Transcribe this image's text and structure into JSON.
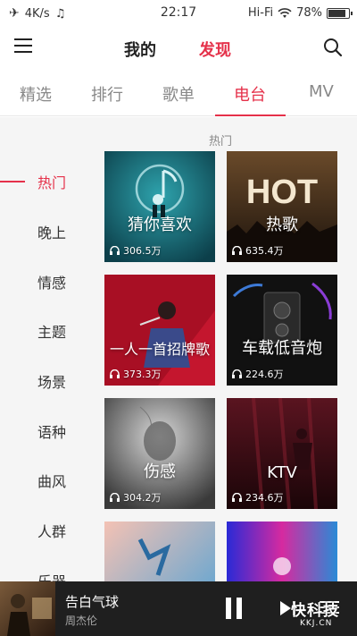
{
  "status_bar": {
    "speed": "4K/s",
    "time": "22:17",
    "network": "Hi-Fi",
    "battery": "78%"
  },
  "header": {
    "tab_mine": "我的",
    "tab_discover": "发现"
  },
  "tabs": [
    "精选",
    "排行",
    "歌单",
    "电台",
    "MV"
  ],
  "active_tab": "电台",
  "sidebar": [
    "热门",
    "晚上",
    "情感",
    "主题",
    "场景",
    "语种",
    "曲风",
    "人群",
    "乐器"
  ],
  "active_category": "热门",
  "section_title": "热门",
  "cards": [
    {
      "title": "猜你喜欢",
      "plays": "306.5万"
    },
    {
      "title": "热歌",
      "plays": "635.4万"
    },
    {
      "title": "一人一首招牌歌",
      "plays": "373.3万"
    },
    {
      "title": "车载低音炮",
      "plays": "224.6万"
    },
    {
      "title": "伤感",
      "plays": "304.2万"
    },
    {
      "title": "KTV",
      "plays": "234.6万"
    },
    {
      "title": "",
      "plays": ""
    },
    {
      "title": "",
      "plays": ""
    }
  ],
  "player": {
    "song": "告白气球",
    "artist": "周杰伦"
  },
  "watermark": {
    "main": "快科技",
    "sub": "KKJ.CN"
  },
  "colors": {
    "accent": "#e5314a",
    "player_bg": "#1f1f1f"
  },
  "icons": {
    "menu": "hamburger-menu-icon",
    "search": "search-icon",
    "pause": "pause-icon",
    "next": "next-track-icon",
    "playlist": "playlist-icon",
    "plays": "headphone-icon"
  }
}
